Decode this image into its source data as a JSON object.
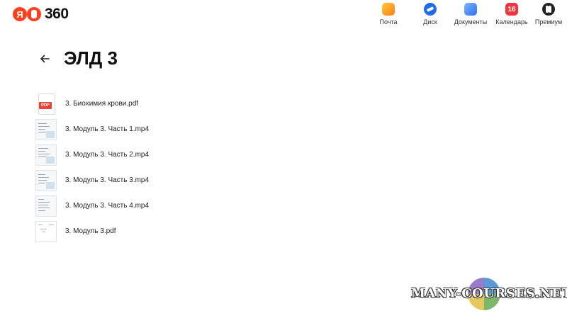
{
  "header": {
    "logo_text": "360",
    "logo_letter": "Я",
    "services": [
      {
        "label": "Почта",
        "icon": "mail-icon"
      },
      {
        "label": "Диск",
        "icon": "disk-icon"
      },
      {
        "label": "Документы",
        "icon": "docs-icon"
      },
      {
        "label": "Календарь",
        "icon": "calendar-icon",
        "badge": "16"
      },
      {
        "label": "Премиум",
        "icon": "premium-icon"
      }
    ]
  },
  "folder": {
    "title": "ЭЛД 3"
  },
  "files": [
    {
      "name": "3. Биохимия крови.pdf",
      "type": "pdf",
      "badge": "PDF"
    },
    {
      "name": "3. Модуль 3. Часть 1.mp4",
      "type": "video"
    },
    {
      "name": "3. Модуль 3. Часть 2.mp4",
      "type": "video"
    },
    {
      "name": "3. Модуль 3. Часть 3.mp4",
      "type": "video"
    },
    {
      "name": "3. Модуль 3. Часть 4.mp4",
      "type": "video"
    },
    {
      "name": "3. Модуль 3.pdf",
      "type": "pdf-preview"
    }
  ],
  "watermark": {
    "text": "MANY-COURSES.NET"
  },
  "colors": {
    "brand": "#fc3f1d",
    "pdf_badge": "#ee4035"
  }
}
